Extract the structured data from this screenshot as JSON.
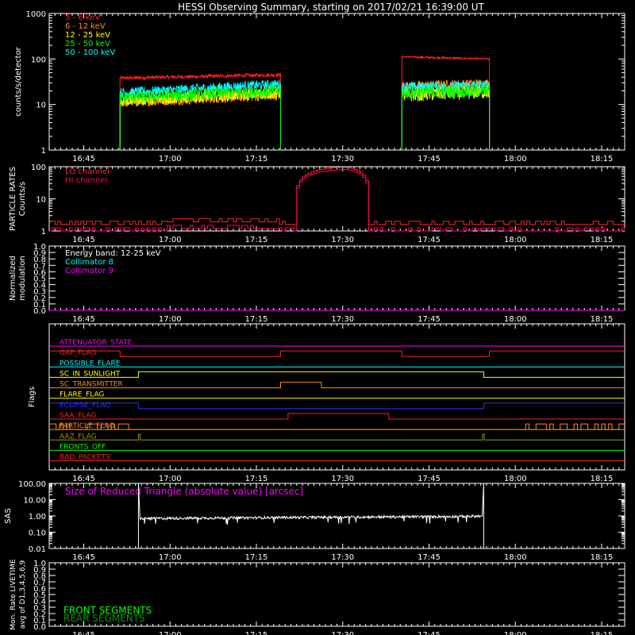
{
  "title": "HESSI Observing Summary, starting on 2017/02/21 16:39:00 UT",
  "colors": {
    "bg": "#000000",
    "axis": "#ffffff",
    "red": "#ff2020",
    "orange": "#ff8c1a",
    "yellow": "#ffff00",
    "green": "#00ff00",
    "cyan": "#00ffff",
    "magenta": "#ff00ff",
    "pink": "#ff0066",
    "blue": "#3030ff",
    "olive": "#999900"
  },
  "time_axis": {
    "xlim_minutes": [
      0,
      100
    ],
    "ticks": [
      {
        "t": 6,
        "label": "16:45"
      },
      {
        "t": 21,
        "label": "17:00"
      },
      {
        "t": 36,
        "label": "17:15"
      },
      {
        "t": 51,
        "label": "17:30"
      },
      {
        "t": 66,
        "label": "17:45"
      },
      {
        "t": 81,
        "label": "18:00"
      },
      {
        "t": 96,
        "label": "18:15"
      }
    ]
  },
  "chart_data": [
    {
      "id": "rates",
      "type": "line",
      "ylabel": "counts/s/detector",
      "yscale": "log",
      "ylim": [
        1,
        1000
      ],
      "yticks": [
        "1",
        "10",
        "100",
        "1000"
      ],
      "series": [
        {
          "name": "3 - 6 keV",
          "color": "#ff2020",
          "segments": [
            {
              "t0": 12.3,
              "t1": 40.2,
              "y0": 38,
              "y1": 45,
              "noise": 0.08
            },
            {
              "t0": 61.3,
              "t1": 76.5,
              "y0": 112,
              "y1": 100,
              "noise": 0.04
            }
          ]
        },
        {
          "name": "6 - 12 keV",
          "color": "#ff8c1a",
          "segments": [
            {
              "t0": 12.3,
              "t1": 40.2,
              "y0": 11,
              "y1": 16,
              "noise": 0.22
            },
            {
              "t0": 61.3,
              "t1": 76.5,
              "y0": 26,
              "y1": 30,
              "noise": 0.18
            }
          ]
        },
        {
          "name": "12 - 25 keV",
          "color": "#ffff00",
          "segments": [
            {
              "t0": 12.3,
              "t1": 40.2,
              "y0": 12,
              "y1": 18,
              "noise": 0.25
            },
            {
              "t0": 61.3,
              "t1": 76.5,
              "y0": 16,
              "y1": 19,
              "noise": 0.3
            }
          ]
        },
        {
          "name": "25 - 50 keV",
          "color": "#00ff00",
          "segments": [
            {
              "t0": 12.3,
              "t1": 40.2,
              "y0": 14,
              "y1": 20,
              "noise": 0.25
            },
            {
              "t0": 61.3,
              "t1": 76.5,
              "y0": 18,
              "y1": 20,
              "noise": 0.28
            }
          ]
        },
        {
          "name": "50 - 100 keV",
          "color": "#00ffff",
          "segments": [
            {
              "t0": 12.3,
              "t1": 40.2,
              "y0": 18,
              "y1": 28,
              "noise": 0.22
            },
            {
              "t0": 61.3,
              "t1": 76.5,
              "y0": 24,
              "y1": 26,
              "noise": 0.22
            }
          ]
        }
      ]
    },
    {
      "id": "particle",
      "type": "line",
      "ylabel": "PARTICLE RATES",
      "ylabel2": "Counts/s",
      "yscale": "log",
      "ylim": [
        1,
        100
      ],
      "yticks": [
        "1",
        "10",
        "100"
      ],
      "series": [
        {
          "name": "LO channel",
          "color": "#ff2020",
          "base": 1.6
        },
        {
          "name": "HI channel",
          "color": "#ff0066",
          "base": 1.0
        }
      ],
      "peak": {
        "t_start": 42.5,
        "t_center": 51,
        "t_end": 55.5,
        "value": 95
      }
    },
    {
      "id": "modulation",
      "type": "line",
      "ylabel": "Normalized",
      "ylabel2": "modulation",
      "ylim": [
        0,
        1
      ],
      "yticks": [
        "0.0",
        "0.1",
        "0.2",
        "0.3",
        "0.4",
        "0.5",
        "0.6",
        "0.7",
        "0.8",
        "0.9",
        "1.0"
      ],
      "annotations": [
        {
          "text": "Energy band: 12-25 keV",
          "color": "#ffffff"
        },
        {
          "text": "Collimator 8",
          "color": "#00ffff"
        },
        {
          "text": "Collimator 9",
          "color": "#ff00ff"
        }
      ],
      "series": [
        {
          "name": "Collimator 9",
          "color": "#ff00ff",
          "value": 0.0
        }
      ]
    },
    {
      "id": "flags",
      "type": "line",
      "ylabel": "Flags",
      "series": [
        {
          "name": "ATTENUATOR_STATE",
          "color": "#ff00ff",
          "on": []
        },
        {
          "name": "GAP_FLAG",
          "color": "#ff2020",
          "on": [
            [
              0,
              12.3
            ],
            [
              40.2,
              61.3
            ],
            [
              76.5,
              100
            ]
          ]
        },
        {
          "name": "POSSIBLE_FLARE",
          "color": "#00ffff",
          "on": []
        },
        {
          "name": "SC_IN_SUNLIGHT",
          "color": "#ffff00",
          "on": [
            [
              15.5,
              75.5
            ]
          ]
        },
        {
          "name": "SC_TRANSMITTER",
          "color": "#ff8c1a",
          "on": [
            [
              40.2,
              47.3
            ]
          ]
        },
        {
          "name": "FLARE_FLAG",
          "color": "#ffff00",
          "on": []
        },
        {
          "name": "ECLIPSE_FLAG",
          "color": "#3030ff",
          "on": [
            [
              0,
              15.5
            ],
            [
              75.5,
              100
            ]
          ]
        },
        {
          "name": "SAA_FLAG",
          "color": "#ff2020",
          "on": [
            [
              41.5,
              59
            ]
          ]
        },
        {
          "name": "PARTICLE_FLAG",
          "color": "#ff8c1a",
          "on": []
        },
        {
          "name": "AAZ_FLAG",
          "color": "#999900",
          "on": [
            [
              15.5,
              15.8
            ],
            [
              75.3,
              75.6
            ]
          ]
        },
        {
          "name": "FRONTS_OFF",
          "color": "#00ff00",
          "on": []
        },
        {
          "name": "BAD_PACKETS",
          "color": "#ff2020",
          "on": []
        }
      ]
    },
    {
      "id": "sas",
      "type": "line",
      "ylabel": "SAS",
      "yscale": "log",
      "ylim": [
        0.01,
        100
      ],
      "yticks": [
        "0.01",
        "0.10",
        "1.00",
        "10.00",
        "100.00"
      ],
      "annotation": {
        "text": "Size of Reduced Triangle (absolute value) [arcsec]",
        "color": "#ff00ff"
      },
      "series": [
        {
          "name": "Size of Reduced Triangle",
          "color": "#ffffff",
          "t0": 15.5,
          "t1": 75.5,
          "y0": 0.7,
          "y1": 0.95,
          "spike": 100
        }
      ]
    },
    {
      "id": "livetime",
      "type": "line",
      "ylabel": "Mon. Rate LIVETIME",
      "ylabel2": "avg of D1,3,4,5,6,9",
      "ylim": [
        0,
        1
      ],
      "yticks": [
        "0.0",
        "0.1",
        "0.2",
        "0.3",
        "0.4",
        "0.5",
        "0.6",
        "0.7",
        "0.8",
        "0.9",
        "1.0"
      ],
      "series": [
        {
          "name": "FRONT SEGMENTS",
          "color": "#00ff00"
        },
        {
          "name": "REAR SEGMENTS",
          "color": "#009900"
        }
      ]
    }
  ]
}
